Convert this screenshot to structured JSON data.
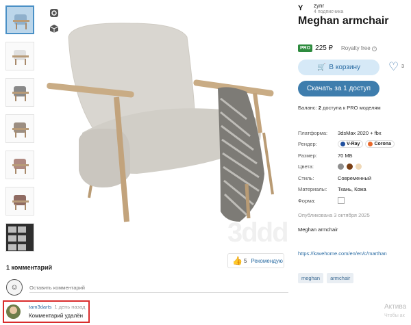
{
  "thumbnails": [
    {
      "name": "thumb-1",
      "seat": "#9bb8d1",
      "active": true
    },
    {
      "name": "thumb-2",
      "seat": "#e2e2e2"
    },
    {
      "name": "thumb-3",
      "seat": "#8a8a8a"
    },
    {
      "name": "thumb-4",
      "seat": "#9c8e82"
    },
    {
      "name": "thumb-5",
      "seat": "#b08a82"
    },
    {
      "name": "thumb-6",
      "seat": "#8f6b62"
    },
    {
      "name": "thumb-7",
      "seat": "#2e2e2e"
    }
  ],
  "viewer": {
    "icons": [
      "3d-view-icon",
      "cube-icon"
    ],
    "watermark": "3ddd"
  },
  "author": {
    "logo": "Y",
    "name": "zynr",
    "subscribers": "4 подписчика"
  },
  "product": {
    "title": "Meghan armchair",
    "pro_badge": "PRO",
    "price": "225 ₽",
    "license": "Royalty free",
    "cart_button": "В корзину",
    "likes": "3",
    "download_button": "Скачать за 1 доступ",
    "balance_prefix": "Баланс:",
    "balance_value": "2",
    "balance_suffix": "доступа к PRO моделям"
  },
  "specs": {
    "platform_label": "Платформа:",
    "platform_value": "3dsMax 2020 + fbx",
    "render_label": "Рендер:",
    "renderers": [
      {
        "name": "V-Ray",
        "color": "#1f4f9e"
      },
      {
        "name": "Corona",
        "color": "#e8682a"
      }
    ],
    "size_label": "Размер:",
    "size_value": "70 МБ",
    "colors_label": "Цвета:",
    "colors": [
      "#8e8e8e",
      "#7a3f15",
      "#f0d9b8"
    ],
    "style_label": "Стиль:",
    "style_value": "Современный",
    "materials_label": "Материалы:",
    "materials_value": "Ткань, Кожа",
    "form_label": "Форма:"
  },
  "published": "Опубликована 3 октября 2025",
  "description": "Meghan armchair",
  "link": "https://kavehome.com/en/en/c/marthan",
  "tags": [
    "meghan",
    "armchair"
  ],
  "recommend": {
    "count": "5",
    "label": "Рекомендую"
  },
  "comments": {
    "count_label": "1 комментарий",
    "input_placeholder": "Оставить комментарий",
    "items": [
      {
        "user": "tam3darts",
        "time": "1 день назад",
        "text": "Комментарий удалён"
      }
    ]
  },
  "os_overlay": {
    "line1": "Актива",
    "line2": "Чтобы ак"
  }
}
